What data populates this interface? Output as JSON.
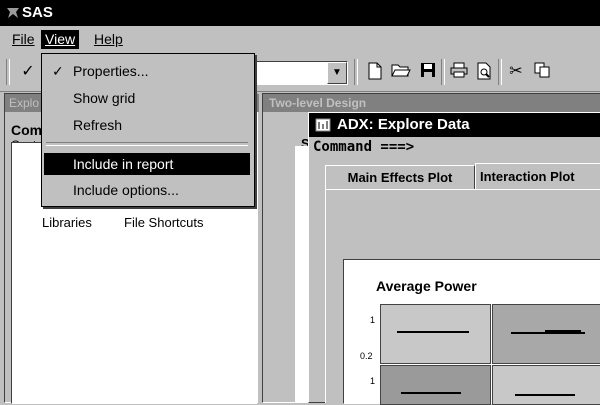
{
  "app": {
    "title": "SAS"
  },
  "menubar": {
    "file": "File",
    "view": "View",
    "help": "Help"
  },
  "view_menu": {
    "items": [
      {
        "label": "Properties...",
        "checked": true
      },
      {
        "label": "Show grid"
      },
      {
        "label": "Refresh"
      },
      {
        "label": "Include in report",
        "highlighted": true
      },
      {
        "label": "Include options..."
      }
    ]
  },
  "explorer": {
    "header": "Explo",
    "contents_title": "Com",
    "contents_sub": "Cont",
    "items": [
      "Libraries",
      "File Shortcuts"
    ]
  },
  "workspace": {
    "header": "Two-level Design",
    "stub_letter": "S"
  },
  "adx": {
    "title": "ADX: Explore Data",
    "command": "Command ===>",
    "tabs": [
      "Main Effects Plot",
      "Interaction Plot"
    ],
    "plot_title": "Average Power",
    "y_ticks": [
      "1",
      "0.2",
      "1"
    ]
  }
}
